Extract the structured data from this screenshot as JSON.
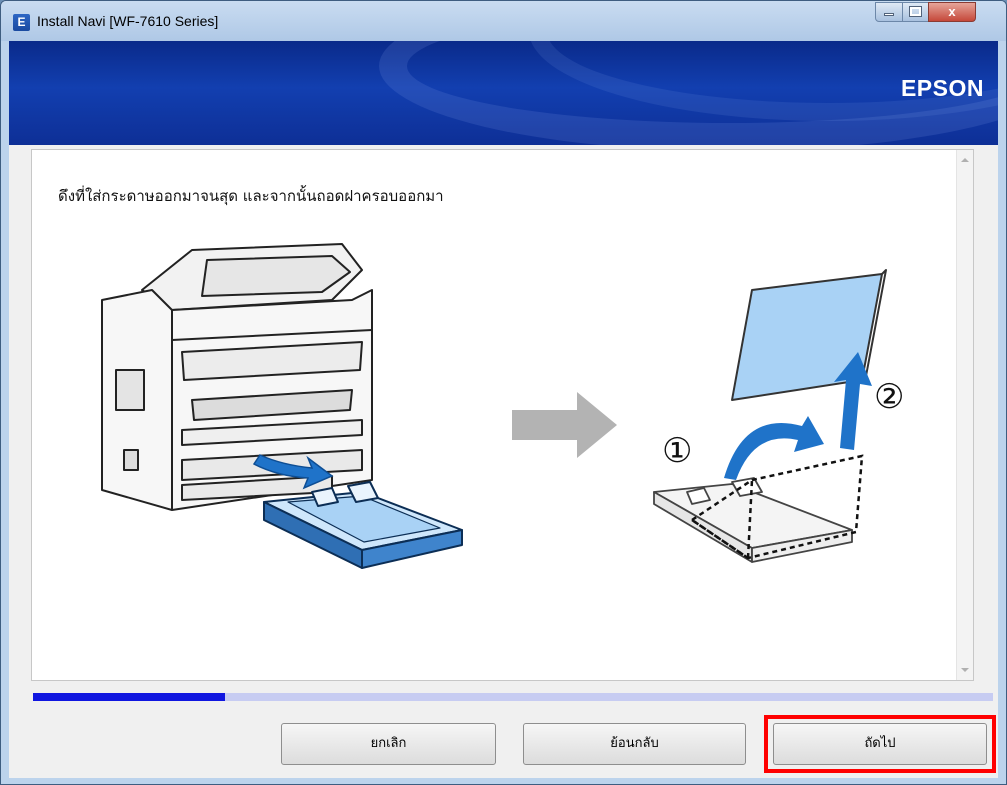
{
  "window": {
    "title": "Install Navi [WF-7610 Series]",
    "app_icon_letter": "E",
    "minimize_icon": "minimize-icon",
    "maximize_icon": "maximize-icon",
    "close_label": "x"
  },
  "banner": {
    "logo": "EPSON"
  },
  "step": {
    "instruction": "ดึงที่ใส่กระดาษออกมาจนสุด และจากนั้นถอดฝาครอบออกมา",
    "marker_1": "①",
    "marker_2": "②"
  },
  "progress": {
    "fraction": 0.2
  },
  "buttons": {
    "cancel": "ยกเลิก",
    "back": "ย้อนกลับ",
    "next": "ถัดไป"
  },
  "colors": {
    "banner_blue": "#123fb0",
    "progress_fill": "#1016e0",
    "progress_track": "#c7ccf2",
    "highlight_red": "#ff0000",
    "illustration_blue": "#1f73c9",
    "paper_blue": "#a9d2f5"
  }
}
